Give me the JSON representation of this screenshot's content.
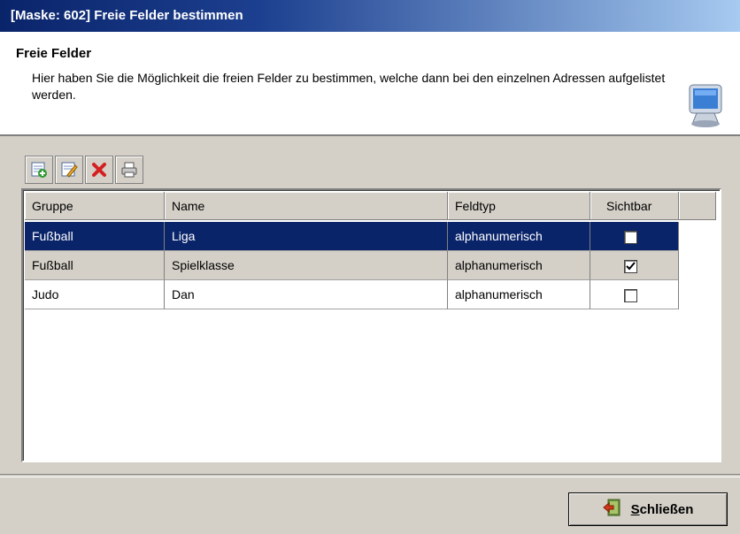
{
  "window": {
    "title": "[Maske: 602] Freie Felder bestimmen"
  },
  "header": {
    "title": "Freie Felder",
    "description": "Hier haben Sie die Möglichkeit die freien Felder zu bestimmen, welche dann bei den einzelnen Adressen aufgelistet werden.",
    "icon": "computer-monitor-icon"
  },
  "toolbar": {
    "buttons": [
      {
        "name": "add-record-icon"
      },
      {
        "name": "edit-record-icon"
      },
      {
        "name": "delete-icon"
      },
      {
        "name": "print-icon"
      }
    ]
  },
  "table": {
    "columns": [
      "Gruppe",
      "Name",
      "Feldtyp",
      "Sichtbar"
    ],
    "rows": [
      {
        "gruppe": "Fußball",
        "name": "Liga",
        "feldtyp": "alphanumerisch",
        "sichtbar": false,
        "state": "selected"
      },
      {
        "gruppe": "Fußball",
        "name": "Spielklasse",
        "feldtyp": "alphanumerisch",
        "sichtbar": true,
        "state": "alt"
      },
      {
        "gruppe": "Judo",
        "name": "Dan",
        "feldtyp": "alphanumerisch",
        "sichtbar": false,
        "state": "normal"
      }
    ]
  },
  "footer": {
    "close_mnemonic": "S",
    "close_rest": "chließen",
    "close_icon": "exit-door-icon"
  },
  "colors": {
    "selection": "#0a246a",
    "face": "#d4d0c8",
    "title_gradient_start": "#0a246a",
    "title_gradient_end": "#a6caf0"
  }
}
